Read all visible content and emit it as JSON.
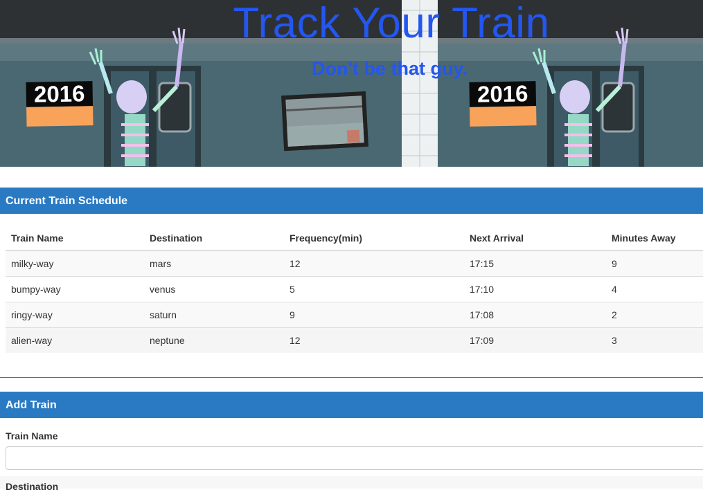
{
  "header": {
    "title": "Track Your Train",
    "subtitle": "Don't be that guy.",
    "badge_year": "2016"
  },
  "schedule": {
    "heading": "Current Train Schedule",
    "columns": [
      "Train Name",
      "Destination",
      "Frequency(min)",
      "Next Arrival",
      "Minutes Away"
    ],
    "rows": [
      [
        "milky-way",
        "mars",
        "12",
        "17:15",
        "9"
      ],
      [
        "bumpy-way",
        "venus",
        "5",
        "17:10",
        "4"
      ],
      [
        "ringy-way",
        "saturn",
        "9",
        "17:08",
        "2"
      ],
      [
        "alien-way",
        "neptune",
        "12",
        "17:09",
        "3"
      ]
    ]
  },
  "add_train": {
    "heading": "Add Train",
    "train_name_label": "Train Name",
    "train_name_value": "",
    "destination_label": "Destination"
  },
  "colors": {
    "accent": "#2a7ac3",
    "title_blue": "#2456f0",
    "badge_orange": "#f9a35a"
  }
}
